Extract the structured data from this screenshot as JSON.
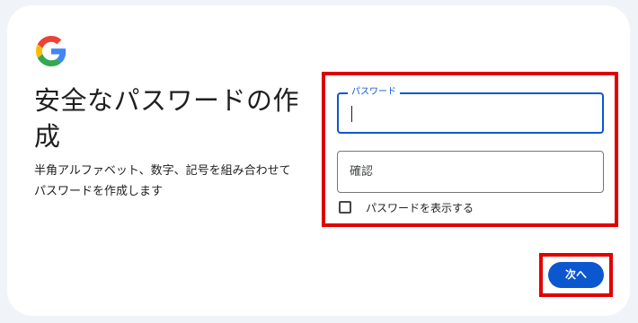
{
  "logo": {
    "icon": "google-g-icon",
    "colors": {
      "blue": "#4285F4",
      "red": "#EA4335",
      "yellow": "#FBBC05",
      "green": "#34A853"
    }
  },
  "heading": {
    "title_line1": "安全なパスワードの作",
    "title_line2": "成",
    "subtitle_line1": "半角アルファベット、数字、記号を組み合わせて",
    "subtitle_line2": "パスワードを作成します"
  },
  "form": {
    "password_label": "パスワード",
    "password_value": "",
    "confirm_placeholder": "確認",
    "confirm_value": "",
    "show_password_label": "パスワードを表示する",
    "show_password_checked": false
  },
  "actions": {
    "next_label": "次へ"
  },
  "colors": {
    "accent": "#0b57d0",
    "highlight": "#e00000",
    "page_background": "#f0f4f9",
    "card_background": "#ffffff"
  }
}
